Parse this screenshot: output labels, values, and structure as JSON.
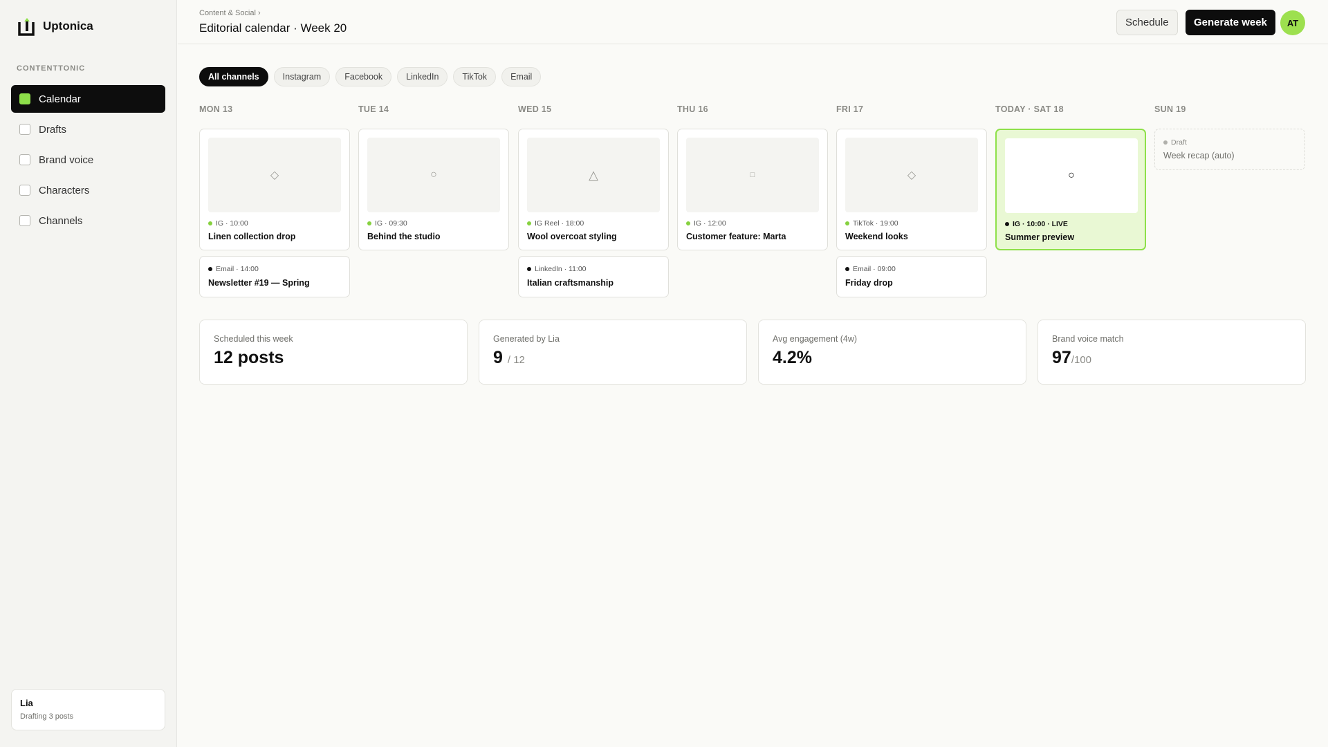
{
  "app": {
    "name": "Uptonica",
    "section": "CONTENTTONIC"
  },
  "sidebar": {
    "items": [
      {
        "label": "Calendar",
        "active": true
      },
      {
        "label": "Drafts",
        "active": false
      },
      {
        "label": "Brand voice",
        "active": false
      },
      {
        "label": "Characters",
        "active": false
      },
      {
        "label": "Channels",
        "active": false
      }
    ],
    "assistant": {
      "name": "Lia",
      "status": "Drafting 3 posts"
    }
  },
  "header": {
    "breadcrumb": "Content & Social ›",
    "title": "Editorial calendar · Week 20",
    "schedule_label": "Schedule",
    "generate_label": "Generate week",
    "avatar_initials": "AT"
  },
  "filters": [
    "All channels",
    "Instagram",
    "Facebook",
    "LinkedIn",
    "TikTok",
    "Email"
  ],
  "days": [
    {
      "label": "MON 13"
    },
    {
      "label": "TUE 14"
    },
    {
      "label": "WED 15"
    },
    {
      "label": "THU 16"
    },
    {
      "label": "FRI 17"
    },
    {
      "label": "TODAY · SAT 18"
    },
    {
      "label": "SUN 19"
    }
  ],
  "posts": {
    "mon_main": {
      "meta": "IG · 10:00",
      "title": "Linen collection drop",
      "icon": "◇"
    },
    "mon_email": {
      "meta": "Email · 14:00",
      "title": "Newsletter #19 — Spring"
    },
    "tue_main": {
      "meta": "IG · 09:30",
      "title": "Behind the studio",
      "icon": "○"
    },
    "wed_main": {
      "meta": "IG Reel · 18:00",
      "title": "Wool overcoat styling",
      "icon": "△"
    },
    "wed_linkedin": {
      "meta": "LinkedIn · 11:00",
      "title": "Italian craftsmanship"
    },
    "thu_main": {
      "meta": "IG · 12:00",
      "title": "Customer feature: Marta",
      "icon": "□"
    },
    "fri_main": {
      "meta": "TikTok · 19:00",
      "title": "Weekend looks",
      "icon": "◇"
    },
    "fri_email": {
      "meta": "Email · 09:00",
      "title": "Friday drop"
    },
    "sat_main": {
      "meta": "IG · 10:00 · LIVE",
      "title": "Summer preview",
      "icon": "○"
    },
    "sun_draft": {
      "meta": "Draft",
      "title": "Week recap (auto)"
    }
  },
  "stats": {
    "scheduled": {
      "label": "Scheduled this week",
      "value": "12 posts"
    },
    "generated": {
      "label": "Generated by Lia",
      "value": "9",
      "suffix": "/ 12"
    },
    "engagement": {
      "label": "Avg engagement (4w)",
      "value": "4.2%"
    },
    "voice": {
      "label": "Brand voice match",
      "value": "97",
      "suffix": "/100"
    }
  },
  "colors": {
    "accent": "#8ee04a",
    "dark": "#0d0d0d",
    "today_bg": "#e9f8d4"
  }
}
